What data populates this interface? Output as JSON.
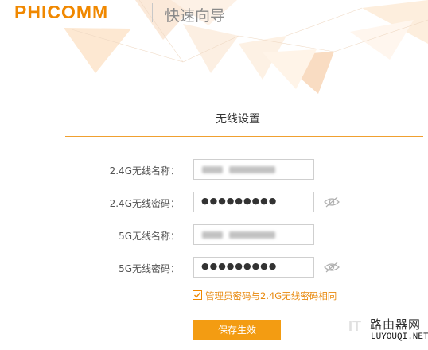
{
  "header": {
    "logo": "PHICOMM",
    "title": "快速向导"
  },
  "section": {
    "title": "无线设置"
  },
  "form": {
    "ssid24_label": "2.4G无线名称：",
    "pwd24_label": "2.4G无线密码：",
    "pwd24_value": "●●●●●●●●●",
    "ssid5_label": "5G无线名称：",
    "pwd5_label": "5G无线密码：",
    "pwd5_value": "●●●●●●●●●",
    "same_password_label": "管理员密码与2.4G无线密码相同",
    "same_password_checked": true,
    "save_label": "保存生效"
  },
  "watermark": {
    "it": "IT",
    "cn": "路由器网",
    "domain": "LUYOUQI.NET"
  },
  "colors": {
    "brand": "#f08800",
    "button": "#f39c12",
    "divider": "#f0a030"
  }
}
